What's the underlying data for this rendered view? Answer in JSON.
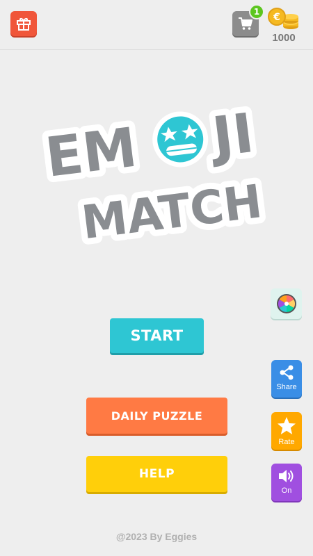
{
  "header": {
    "cart_badge": "1",
    "coins": "1000"
  },
  "logo": {
    "line1_left": "EM",
    "line1_right": "JI",
    "line2": "MATCH"
  },
  "menu": {
    "start_label": "START",
    "daily_label": "DAILY PUZZLE",
    "help_label": "HELP"
  },
  "side": {
    "share_label": "Share",
    "rate_label": "Rate",
    "sound_label": "On"
  },
  "footer": {
    "text": "@2023 By Eggies"
  },
  "colors": {
    "background": "#eeeeee",
    "gift": "#f0563a",
    "cart": "#8c8c8c",
    "badge": "#5cc61f",
    "start": "#2ec6d3",
    "daily": "#ff7a44",
    "help": "#ffcf0a",
    "share": "#3a8ee6",
    "rate": "#ffa800",
    "sound": "#a04fe0",
    "logo_text": "#8a8d91",
    "emoji_face": "#2ec6d3"
  },
  "icons": [
    "gift-icon",
    "cart-icon",
    "coins-icon",
    "emoji-face-icon",
    "wheel-icon",
    "share-icon",
    "star-icon",
    "speaker-icon"
  ]
}
